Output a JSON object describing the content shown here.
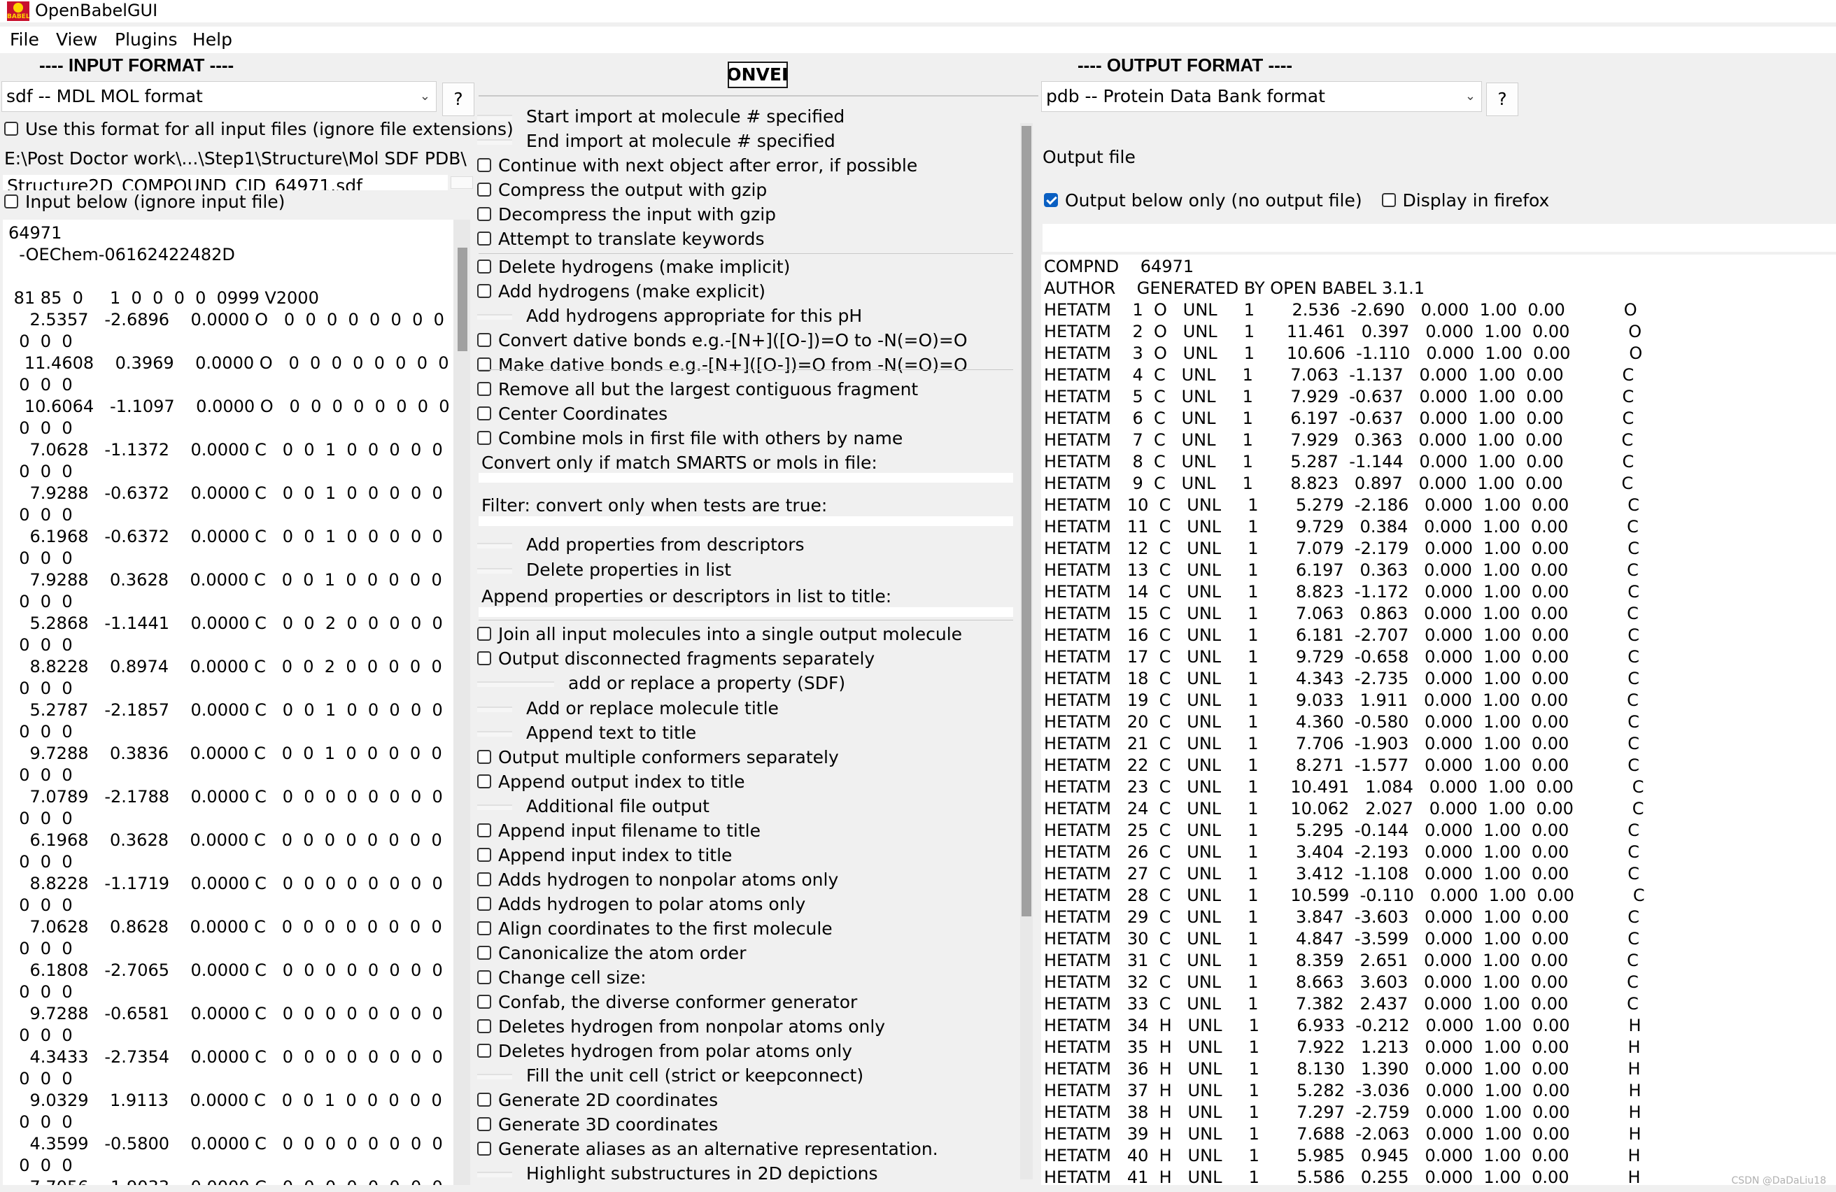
{
  "window": {
    "title": "OpenBabelGUI",
    "icon": "babel-logo-icon"
  },
  "menu": [
    "File",
    "View",
    "Plugins",
    "Help"
  ],
  "input_panel": {
    "heading": "---- INPUT FORMAT ----",
    "format_selected": "sdf -- MDL MOL format",
    "help_label": "?",
    "use_format_all_label": "Use this format for all input files (ignore file extensions)",
    "use_format_all_checked": false,
    "path_line1": "E:\\Post Doctor work\\...\\Step1\\Structure\\Mol SDF PDB\\",
    "path_line2": "Structure2D_COMPOUND_CID_64971.sdf",
    "input_below_label": "Input below (ignore input file)",
    "input_below_checked": false,
    "text": "64971\n  -OEChem-06162422482D\n\n 81 85  0     1  0  0  0  0  0999 V2000\n    2.5357   -2.6896    0.0000 O   0  0  0  0  0  0  0  0  0  0\n  0  0  0\n   11.4608    0.3969    0.0000 O   0  0  0  0  0  0  0  0  0  0\n  0  0  0\n   10.6064   -1.1097    0.0000 O   0  0  0  0  0  0  0  0  0  0\n  0  0  0\n    7.0628   -1.1372    0.0000 C   0  0  1  0  0  0  0  0  0  0\n  0  0  0\n    7.9288   -0.6372    0.0000 C   0  0  1  0  0  0  0  0  0  0\n  0  0  0\n    6.1968   -0.6372    0.0000 C   0  0  1  0  0  0  0  0  0  0\n  0  0  0\n    7.9288    0.3628    0.0000 C   0  0  1  0  0  0  0  0  0  0\n  0  0  0\n    5.2868   -1.1441    0.0000 C   0  0  2  0  0  0  0  0  0  0\n  0  0  0\n    8.8228    0.8974    0.0000 C   0  0  2  0  0  0  0  0  0  0\n  0  0  0\n    5.2787   -2.1857    0.0000 C   0  0  1  0  0  0  0  0  0  0\n  0  0  0\n    9.7288    0.3836    0.0000 C   0  0  1  0  0  0  0  0  0  0\n  0  0  0\n    7.0789   -2.1788    0.0000 C   0  0  0  0  0  0  0  0  0  0\n  0  0  0\n    6.1968    0.3628    0.0000 C   0  0  0  0  0  0  0  0  0  0\n  0  0  0\n    8.8228   -1.1719    0.0000 C   0  0  0  0  0  0  0  0  0  0\n  0  0  0\n    7.0628    0.8628    0.0000 C   0  0  0  0  0  0  0  0  0  0\n  0  0  0\n    6.1808   -2.7065    0.0000 C   0  0  0  0  0  0  0  0  0  0\n  0  0  0\n    9.7288   -0.6581    0.0000 C   0  0  0  0  0  0  0  0  0  0\n  0  0  0\n    4.3433   -2.7354    0.0000 C   0  0  0  0  0  0  0  0  0  0\n  0  0  0\n    9.0329    1.9113    0.0000 C   0  0  1  0  0  0  0  0  0  0\n  0  0  0\n    4.3599   -0.5800    0.0000 C   0  0  0  0  0  0  0  0  0  0\n  0  0  0\n    7.7056   -1.9033    0.0000 C   0  0  0  0  0  0  0  0  0  0"
  },
  "convert_button_label": "CONVERT",
  "options": [
    {
      "kind": "spin",
      "label": "Start import at molecule # specified"
    },
    {
      "kind": "spin",
      "label": "End import at molecule # specified"
    },
    {
      "kind": "check",
      "label": "Continue with next object after error, if possible"
    },
    {
      "kind": "check",
      "label": "Compress the output with gzip"
    },
    {
      "kind": "check",
      "label": "Decompress the input with gzip"
    },
    {
      "kind": "check",
      "label": "Attempt to translate keywords"
    },
    {
      "kind": "check",
      "label": "Delete hydrogens (make implicit)"
    },
    {
      "kind": "check",
      "label": "Add hydrogens (make explicit)"
    },
    {
      "kind": "spin",
      "label": "Add hydrogens appropriate for this pH"
    },
    {
      "kind": "check",
      "label": "Convert dative bonds e.g.-[N+]([O-])=O to -N(=O)=O"
    },
    {
      "kind": "check",
      "label": "Make dative bonds e.g.-[N+]([O-])=O from -N(=O)=O"
    },
    {
      "kind": "check",
      "label": "Remove all but the largest contiguous fragment"
    },
    {
      "kind": "check",
      "label": "Center Coordinates"
    },
    {
      "kind": "check",
      "label": "Combine mols in first file with others by name"
    },
    {
      "kind": "text",
      "label": "Convert only if match SMARTS or mols in file:"
    },
    {
      "kind": "text",
      "label": "Filter: convert only when tests are true:"
    },
    {
      "kind": "spin",
      "label": "Add properties from descriptors"
    },
    {
      "kind": "spin",
      "label": "Delete properties in list"
    },
    {
      "kind": "text",
      "label": "Append properties or descriptors in list to title:"
    },
    {
      "kind": "check",
      "label": "Join all input molecules into a single output molecule"
    },
    {
      "kind": "check",
      "label": "Output disconnected fragments separately"
    },
    {
      "kind": "spin2",
      "label": "add or replace a property (SDF)"
    },
    {
      "kind": "spin",
      "label": "Add or replace molecule title"
    },
    {
      "kind": "spin",
      "label": "Append text to title"
    },
    {
      "kind": "check",
      "label": "Output multiple conformers separately"
    },
    {
      "kind": "check",
      "label": "Append output index to title"
    },
    {
      "kind": "spin",
      "label": "Additional file output"
    },
    {
      "kind": "check",
      "label": "Append input filename to title"
    },
    {
      "kind": "check",
      "label": "Append input index to title"
    },
    {
      "kind": "check",
      "label": "Adds hydrogen to nonpolar atoms only"
    },
    {
      "kind": "check",
      "label": "Adds hydrogen to polar atoms only"
    },
    {
      "kind": "check",
      "label": "Align coordinates to the first molecule"
    },
    {
      "kind": "check",
      "label": "Canonicalize the atom order"
    },
    {
      "kind": "check",
      "label": "Change cell size:"
    },
    {
      "kind": "check",
      "label": "Confab, the diverse conformer generator"
    },
    {
      "kind": "check",
      "label": "Deletes hydrogen from nonpolar atoms only"
    },
    {
      "kind": "check",
      "label": "Deletes hydrogen from polar atoms only"
    },
    {
      "kind": "spin",
      "label": "Fill the unit cell (strict or keepconnect)"
    },
    {
      "kind": "check",
      "label": "Generate 2D coordinates"
    },
    {
      "kind": "check",
      "label": "Generate 3D coordinates"
    },
    {
      "kind": "check",
      "label": "Generate aliases as an alternative representation."
    },
    {
      "kind": "spin",
      "label": "Highlight substructures in 2D depictions"
    }
  ],
  "output_panel": {
    "heading": "---- OUTPUT FORMAT ----",
    "format_selected": "pdb -- Protein Data Bank format",
    "help_label": "?",
    "output_file_label": "Output file",
    "output_below_label": "Output below only (no output file)",
    "output_below_checked": true,
    "display_firefox_label": "Display in firefox",
    "display_firefox_checked": false,
    "text": "COMPND    64971\nAUTHOR    GENERATED BY OPEN BABEL 3.1.1\nHETATM    1  O   UNL     1       2.536  -2.690   0.000  1.00  0.00           O\nHETATM    2  O   UNL     1      11.461   0.397   0.000  1.00  0.00           O\nHETATM    3  O   UNL     1      10.606  -1.110   0.000  1.00  0.00           O\nHETATM    4  C   UNL     1       7.063  -1.137   0.000  1.00  0.00           C\nHETATM    5  C   UNL     1       7.929  -0.637   0.000  1.00  0.00           C\nHETATM    6  C   UNL     1       6.197  -0.637   0.000  1.00  0.00           C\nHETATM    7  C   UNL     1       7.929   0.363   0.000  1.00  0.00           C\nHETATM    8  C   UNL     1       5.287  -1.144   0.000  1.00  0.00           C\nHETATM    9  C   UNL     1       8.823   0.897   0.000  1.00  0.00           C\nHETATM   10  C   UNL     1       5.279  -2.186   0.000  1.00  0.00           C\nHETATM   11  C   UNL     1       9.729   0.384   0.000  1.00  0.00           C\nHETATM   12  C   UNL     1       7.079  -2.179   0.000  1.00  0.00           C\nHETATM   13  C   UNL     1       6.197   0.363   0.000  1.00  0.00           C\nHETATM   14  C   UNL     1       8.823  -1.172   0.000  1.00  0.00           C\nHETATM   15  C   UNL     1       7.063   0.863   0.000  1.00  0.00           C\nHETATM   16  C   UNL     1       6.181  -2.707   0.000  1.00  0.00           C\nHETATM   17  C   UNL     1       9.729  -0.658   0.000  1.00  0.00           C\nHETATM   18  C   UNL     1       4.343  -2.735   0.000  1.00  0.00           C\nHETATM   19  C   UNL     1       9.033   1.911   0.000  1.00  0.00           C\nHETATM   20  C   UNL     1       4.360  -0.580   0.000  1.00  0.00           C\nHETATM   21  C   UNL     1       7.706  -1.903   0.000  1.00  0.00           C\nHETATM   22  C   UNL     1       8.271  -1.577   0.000  1.00  0.00           C\nHETATM   23  C   UNL     1      10.491   1.084   0.000  1.00  0.00           C\nHETATM   24  C   UNL     1      10.062   2.027   0.000  1.00  0.00           C\nHETATM   25  C   UNL     1       5.295  -0.144   0.000  1.00  0.00           C\nHETATM   26  C   UNL     1       3.404  -2.193   0.000  1.00  0.00           C\nHETATM   27  C   UNL     1       3.412  -1.108   0.000  1.00  0.00           C\nHETATM   28  C   UNL     1      10.599  -0.110   0.000  1.00  0.00           C\nHETATM   29  C   UNL     1       3.847  -3.603   0.000  1.00  0.00           C\nHETATM   30  C   UNL     1       4.847  -3.599   0.000  1.00  0.00           C\nHETATM   31  C   UNL     1       8.359   2.651   0.000  1.00  0.00           C\nHETATM   32  C   UNL     1       8.663   3.603   0.000  1.00  0.00           C\nHETATM   33  C   UNL     1       7.382   2.437   0.000  1.00  0.00           C\nHETATM   34  H   UNL     1       6.933  -0.212   0.000  1.00  0.00           H\nHETATM   35  H   UNL     1       7.922   1.213   0.000  1.00  0.00           H\nHETATM   36  H   UNL     1       8.130   1.390   0.000  1.00  0.00           H\nHETATM   37  H   UNL     1       5.282  -3.036   0.000  1.00  0.00           H\nHETATM   38  H   UNL     1       7.297  -2.759   0.000  1.00  0.00           H\nHETATM   39  H   UNL     1       7.688  -2.063   0.000  1.00  0.00           H\nHETATM   40  H   UNL     1       5.985   0.945   0.000  1.00  0.00           H\nHETATM   41  H   UNL     1       5.586   0.255   0.000  1.00  0.00           H"
  },
  "watermark": "CSDN @DaDaLiu18"
}
